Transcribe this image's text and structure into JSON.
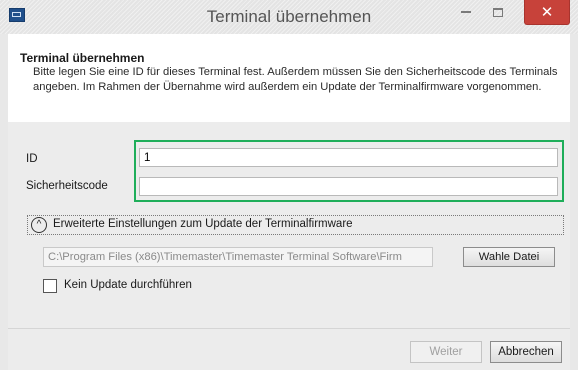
{
  "window": {
    "title": "Terminal übernehmen",
    "close_glyph": "✕"
  },
  "header": {
    "title": "Terminal übernehmen",
    "description": "Bitte legen Sie eine ID für dieses Terminal fest. Außerdem müssen Sie den Sicherheitscode des Terminals angeben. Im Rahmen der Übernahme wird außerdem ein Update der Terminalfirmware vorgenommen."
  },
  "form": {
    "id_label": "ID",
    "id_value": "1",
    "code_label": "Sicherheitscode",
    "code_value": "",
    "highlight_color": "#1fae5a"
  },
  "advanced": {
    "toggle_glyph": "^",
    "label": "Erweiterte Einstellungen zum Update der Terminalfirmware",
    "path_value": "C:\\Program Files (x86)\\Timemaster\\Timemaster Terminal Software\\Firm",
    "browse_label": "Wahle Datei",
    "skip_update_label": "Kein Update durchführen",
    "skip_update_checked": false
  },
  "footer": {
    "next_label": "Weiter",
    "cancel_label": "Abbrechen"
  },
  "colors": {
    "close_button": "#c7423a",
    "app_icon": "#1f4f8b"
  }
}
